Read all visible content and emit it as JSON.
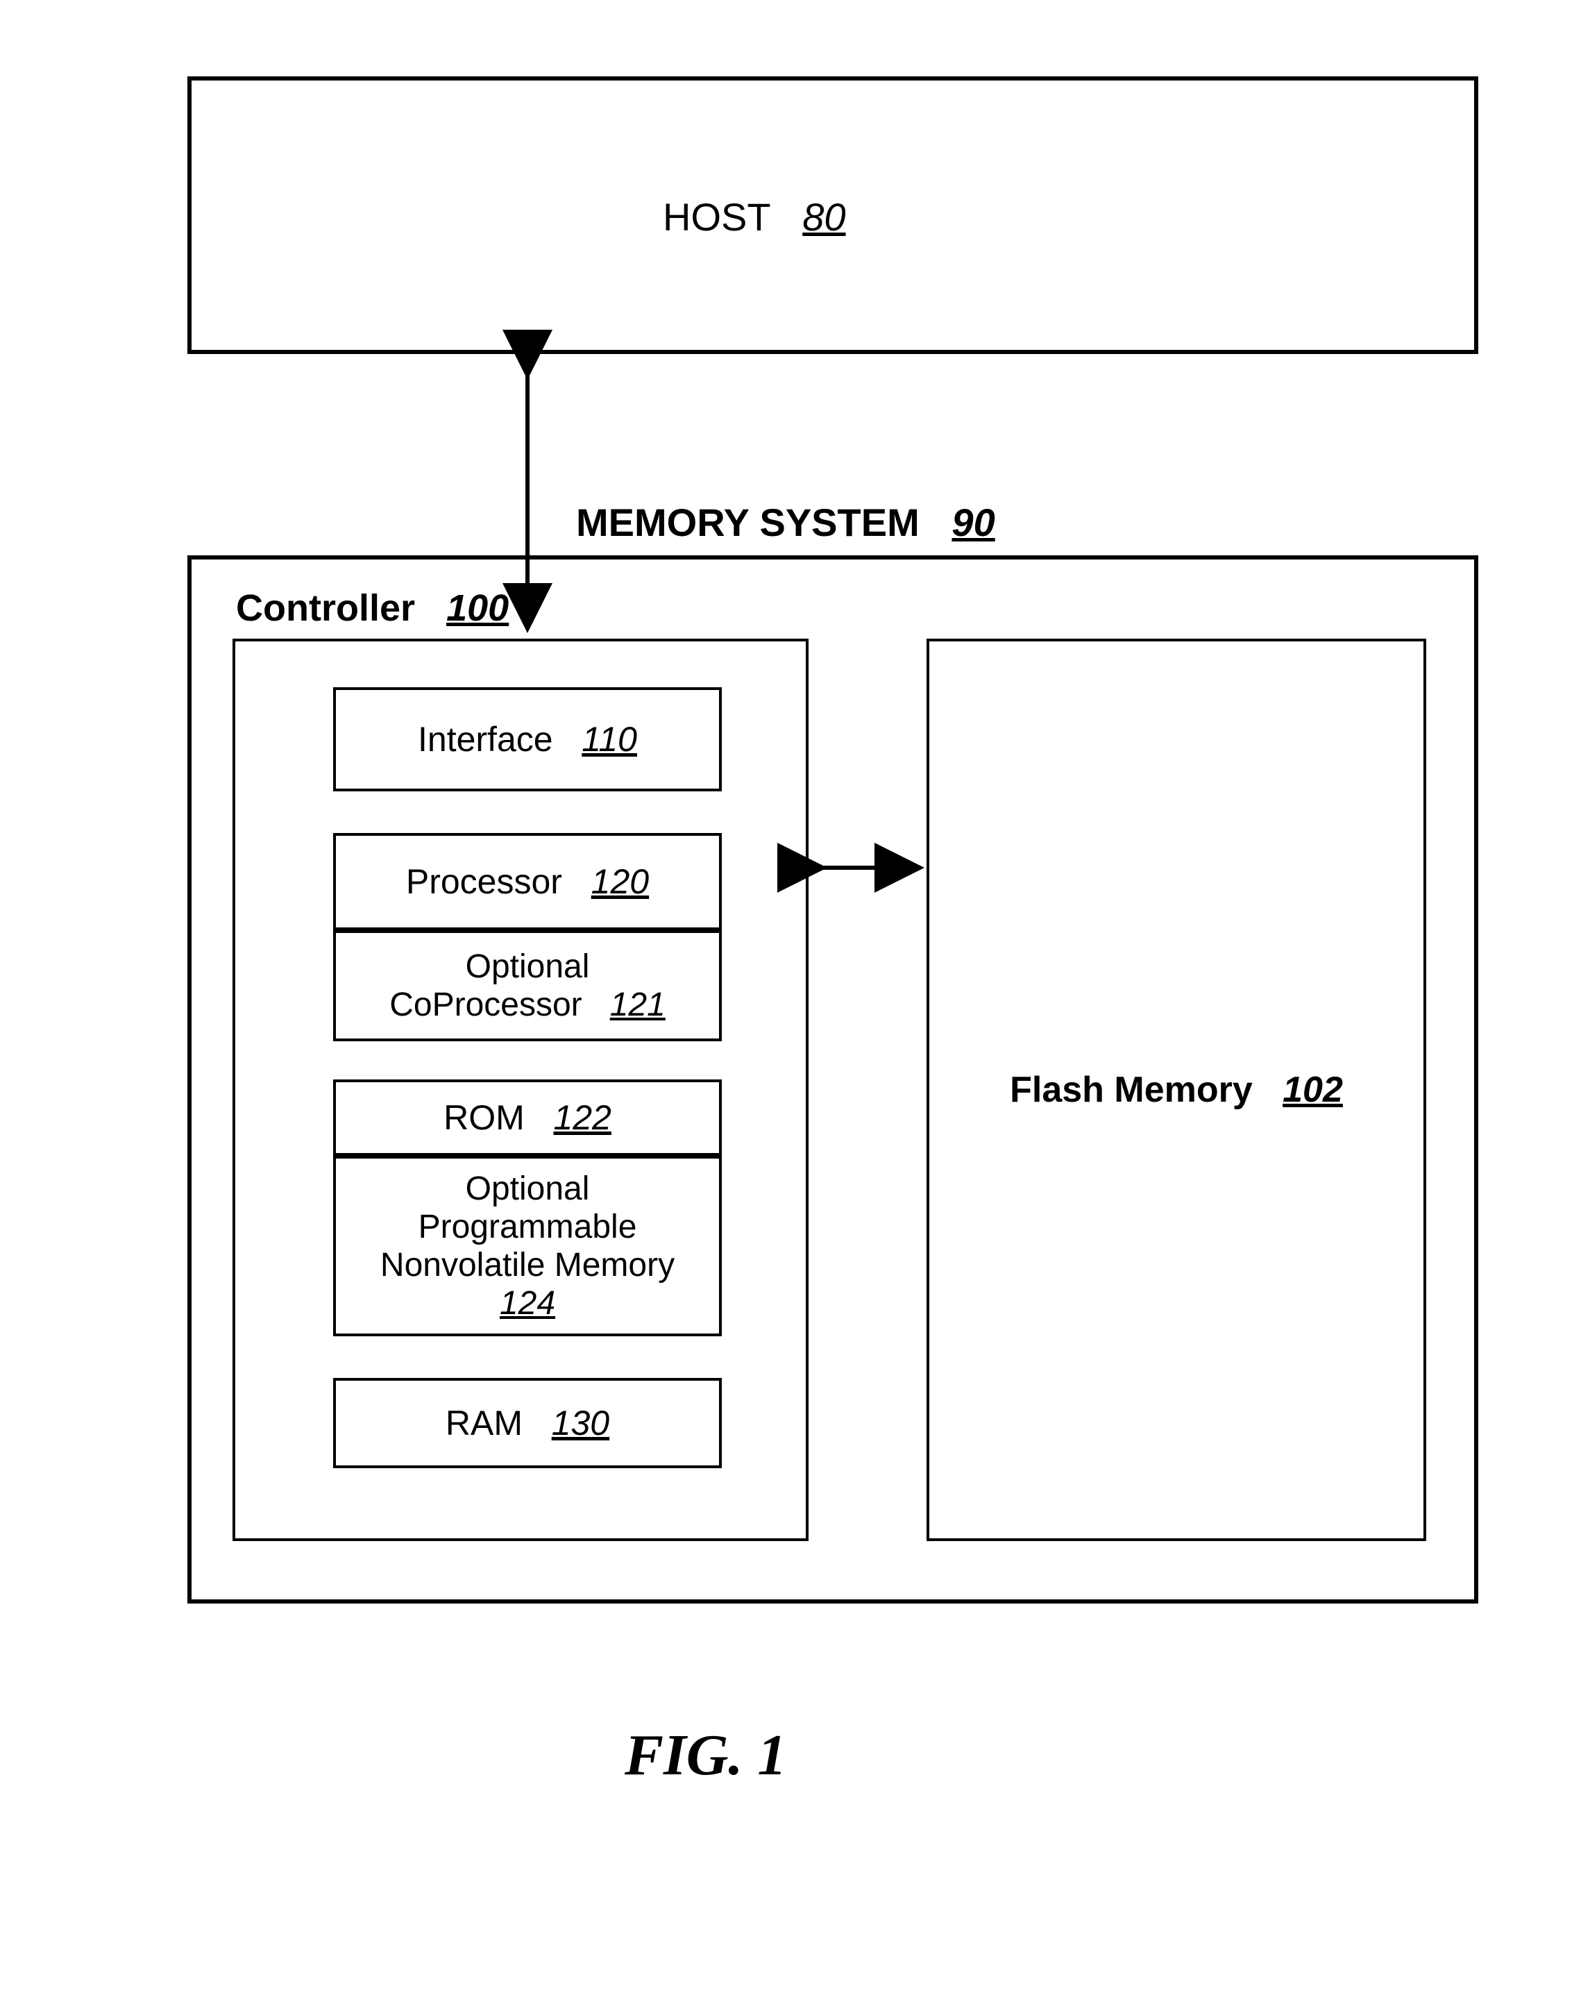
{
  "host": {
    "label": "HOST",
    "ref": "80"
  },
  "memory_system": {
    "label": "MEMORY SYSTEM",
    "ref": "90"
  },
  "controller": {
    "label": "Controller",
    "ref": "100"
  },
  "interface": {
    "label": "Interface",
    "ref": "110"
  },
  "processor": {
    "label": "Processor",
    "ref": "120"
  },
  "coprocessor": {
    "line1": "Optional",
    "line2": "CoProcessor",
    "ref": "121"
  },
  "rom": {
    "label": "ROM",
    "ref": "122"
  },
  "nvm": {
    "line1": "Optional",
    "line2": "Programmable",
    "line3": "Nonvolatile Memory",
    "ref": "124"
  },
  "ram": {
    "label": "RAM",
    "ref": "130"
  },
  "flash": {
    "label": "Flash Memory",
    "ref": "102"
  },
  "figure": "FIG. 1"
}
